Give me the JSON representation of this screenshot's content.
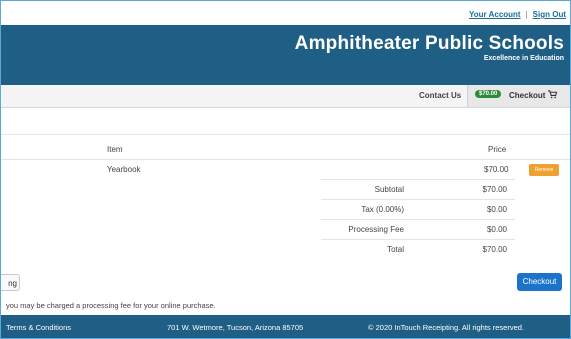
{
  "top_links": {
    "account": "Your Account",
    "separator": "|",
    "sign_out": "Sign Out"
  },
  "header": {
    "title": "Amphitheater Public Schools",
    "subtitle": "Excellence in Education",
    "background": "#1f5f85"
  },
  "nav": {
    "contact": "Contact Us",
    "cart_total": "$70.00",
    "checkout": "Checkout",
    "cart_icon": "shopping-cart-icon"
  },
  "table": {
    "columns": {
      "item": "Item",
      "price": "Price"
    },
    "rows": [
      {
        "item": "Yearbook",
        "price": "$70.00",
        "action": "Remove"
      }
    ]
  },
  "summary": [
    {
      "label": "Subtotal",
      "value": "$70.00"
    },
    {
      "label": "Tax (0.00%)",
      "value": "$0.00"
    },
    {
      "label": "Processing Fee",
      "value": "$0.00"
    },
    {
      "label": "Total",
      "value": "$70.00"
    }
  ],
  "actions": {
    "continue_shopping_visible": "ng",
    "checkout": "Checkout",
    "checkout_color": "#1b74c9",
    "remove_color": "#f0a030"
  },
  "notice": "you may be charged a processing fee for your online purchase.",
  "footer": {
    "terms": "Terms & Conditions",
    "address": "701 W. Wetmore, Tucson, Arizona 85705",
    "copyright": "© 2020 InTouch Receipting. All rights reserved."
  }
}
